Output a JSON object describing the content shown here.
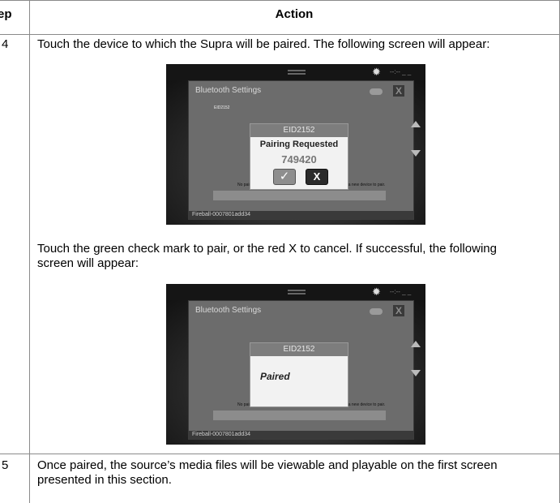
{
  "table": {
    "header_step": "Step",
    "header_action": "Action"
  },
  "rows": [
    {
      "step": "4",
      "instruction": "Touch the device to which the Supra will be paired.  The following screen will appear:",
      "followup": "Touch the green check mark to pair, or the red X to cancel.  If successful, the following screen will appear:"
    },
    {
      "step": "5",
      "instruction": "Once paired, the source’s media files will be viewable and playable on the first screen presented in this section."
    }
  ],
  "screenshot1": {
    "dialog_title": "Bluetooth Settings",
    "device_id": "EID2152",
    "popup_title": "EID2152",
    "popup_status": "Pairing Requested",
    "popup_code": "749420",
    "no_paired_text": "No paired devices. Select SCAN FOR NEW DEVICES to find a new device to pair.",
    "footer": "Fireball-0007801add34",
    "clock": "--:-- _ _"
  },
  "screenshot2": {
    "dialog_title": "Bluetooth Settings",
    "popup_title": "EID2152",
    "popup_status": "Paired",
    "no_paired_text": "No paired devices. Select SCAN FOR NEW DEVICES to find a new device to pair.",
    "footer": "Fireball-0007801add34",
    "clock": "--:-- _ _"
  }
}
